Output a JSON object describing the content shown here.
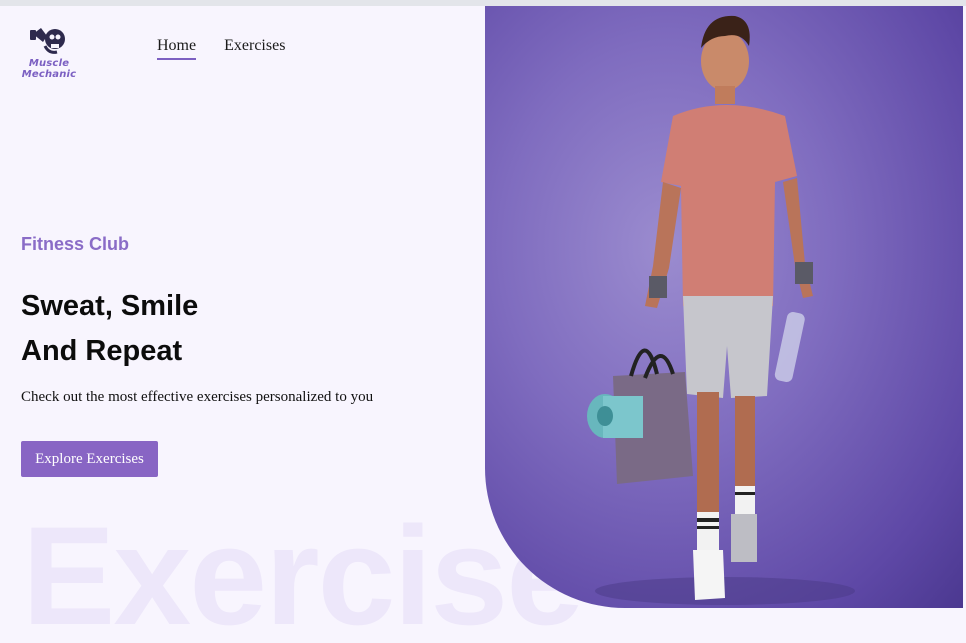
{
  "brand": {
    "name": "Muscle Mechanic",
    "logo_icon": "flexing-skull-icon"
  },
  "nav": {
    "items": [
      {
        "label": "Home",
        "active": true
      },
      {
        "label": "Exercises",
        "active": false
      }
    ]
  },
  "hero": {
    "eyebrow": "Fitness Club",
    "headline_line1": "Sweat, Smile",
    "headline_line2": "And Repeat",
    "subtext": "Check out the most effective exercises personalized to you",
    "cta_label": "Explore Exercises",
    "watermark": "Exercise",
    "image_subject": "man-walking-with-gym-bag-image"
  },
  "colors": {
    "accent": "#8865c4",
    "eyebrow": "#8a6cc7",
    "page_bg": "#f8f5fe",
    "watermark": "#ede7fa",
    "image_bg": "#7f6cbf"
  }
}
